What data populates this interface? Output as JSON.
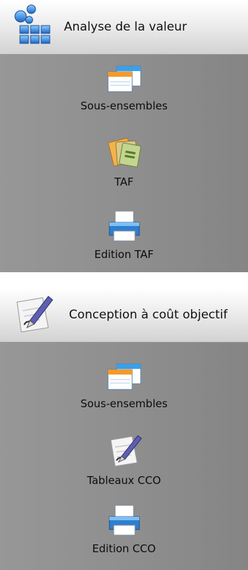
{
  "panels": [
    {
      "title": "Analyse de la valeur",
      "header_icon": "modules-icon",
      "items": [
        {
          "label": "Sous-ensembles",
          "icon": "windows-icon"
        },
        {
          "label": "TAF",
          "icon": "documents-icon"
        },
        {
          "label": "Edition TAF",
          "icon": "printer-icon"
        }
      ]
    },
    {
      "title": "Conception à coût objectif",
      "header_icon": "pen-paper-icon",
      "items": [
        {
          "label": "Sous-ensembles",
          "icon": "windows-icon"
        },
        {
          "label": "Tableaux CCO",
          "icon": "pen-paper-icon"
        },
        {
          "label": "Edition CCO",
          "icon": "printer-icon"
        }
      ]
    }
  ],
  "colors": {
    "header_top": "#ffffff",
    "header_bottom": "#d2d2d2",
    "panel_body": "#8e8e8e",
    "text": "#111111"
  }
}
